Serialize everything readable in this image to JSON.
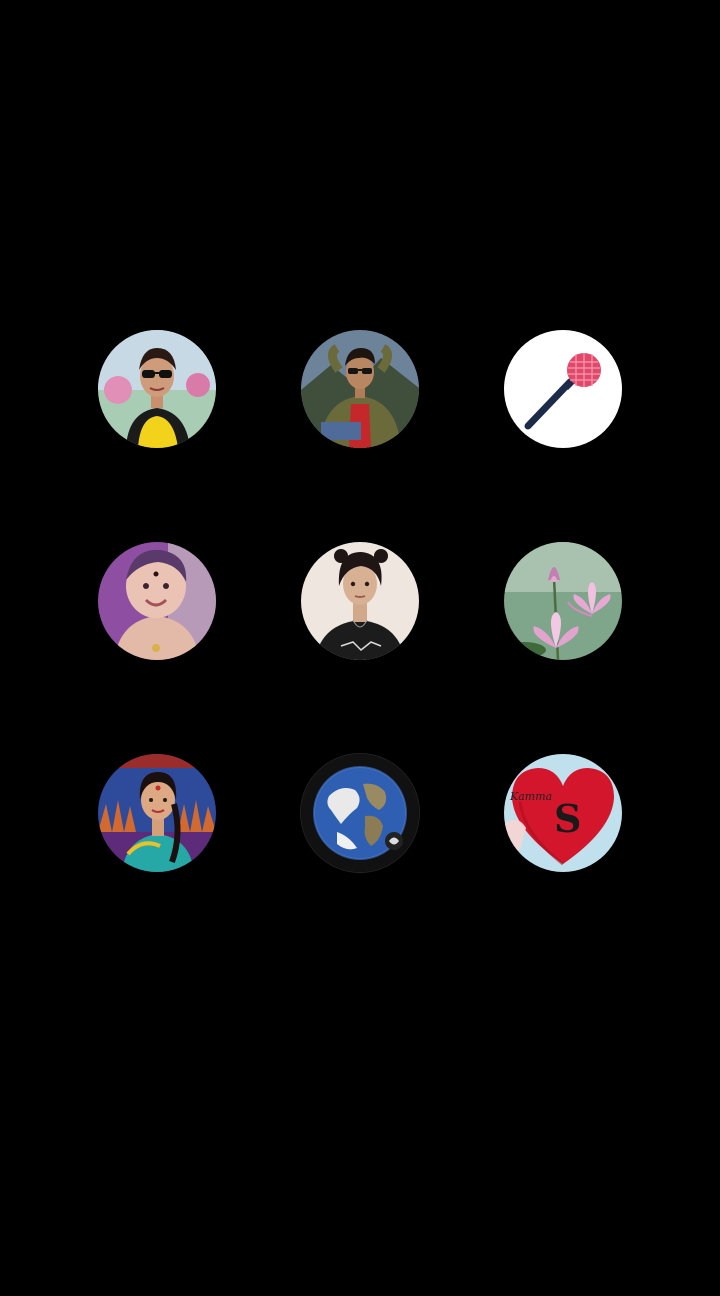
{
  "avatars": [
    {
      "id": "a1",
      "depicts": "woman-sunglasses-yellow-top",
      "bg": "#9ec4a8",
      "accent": "#f2d21a"
    },
    {
      "id": "a2",
      "depicts": "man-red-shirt-jacket",
      "bg": "#5d7690",
      "accent": "#c4282a"
    },
    {
      "id": "a3",
      "depicts": "microphone",
      "bg": "#ffffff",
      "accent": "#e2486a"
    },
    {
      "id": "a4",
      "depicts": "smiling-baby-purple",
      "bg": "#8e4fa2",
      "accent": "#e8c1b0"
    },
    {
      "id": "a5",
      "depicts": "woman-black-tshirt",
      "bg": "#efe6e0",
      "accent": "#1c1c1c"
    },
    {
      "id": "a6",
      "depicts": "pink-lotus-flowers",
      "bg": "#7fa58b",
      "accent": "#e3a3cf"
    },
    {
      "id": "a7",
      "depicts": "woman-traditional-dress",
      "bg": "#2e4a9a",
      "accent": "#c9402e"
    },
    {
      "id": "a8",
      "depicts": "earth-globe",
      "bg": "#111111",
      "accent": "#3b6fc1"
    },
    {
      "id": "a9",
      "depicts": "red-heart-monogram",
      "bg": "#bfe0ec",
      "accent": "#d3162b",
      "monogram": "S"
    }
  ]
}
